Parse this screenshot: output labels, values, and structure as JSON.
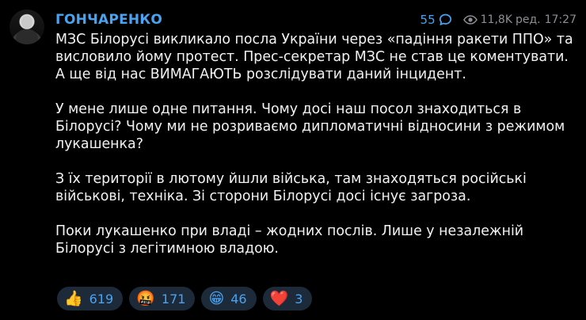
{
  "post": {
    "author": "ГОНЧАРЕНКО",
    "comments_count": "55",
    "views": "11,8K",
    "edited_label": "ред.",
    "time": "17:27",
    "paragraphs": [
      "МЗС Білорусі викликало посла України через «падіння ракети ППО» та висловило йому протест. Прес-секретар МЗС не став це коментувати. А ще від нас ВИМАГАЮТЬ розслідувати даний інцидент.",
      "У мене лише одне питання. Чому досі наш посол знаходиться в Білорусі? Чому ми не розриваємо дипломатичні відносини з режимом лукашенка?",
      "З їх території в лютому йшли війська, там знаходяться російські військові, техніка. Зі сторони Білорусі досі існує загроза.",
      "Поки лукашенко при владі – жодних послів. Лише у незалежній Білорусі з легітимною владою."
    ]
  },
  "reactions": [
    {
      "emoji": "👍",
      "count": "619",
      "icon": "thumbs-up-icon"
    },
    {
      "emoji": "🤬",
      "count": "171",
      "icon": "cursing-face-icon"
    },
    {
      "emoji": "😁",
      "count": "46",
      "icon": "grinning-face-icon"
    },
    {
      "emoji": "❤️",
      "count": "3",
      "icon": "red-heart-icon"
    }
  ],
  "colors": {
    "background": "#000000",
    "accent": "#4aa3f0",
    "reaction_bg": "#1c2a3a",
    "muted": "#8e8e93"
  }
}
